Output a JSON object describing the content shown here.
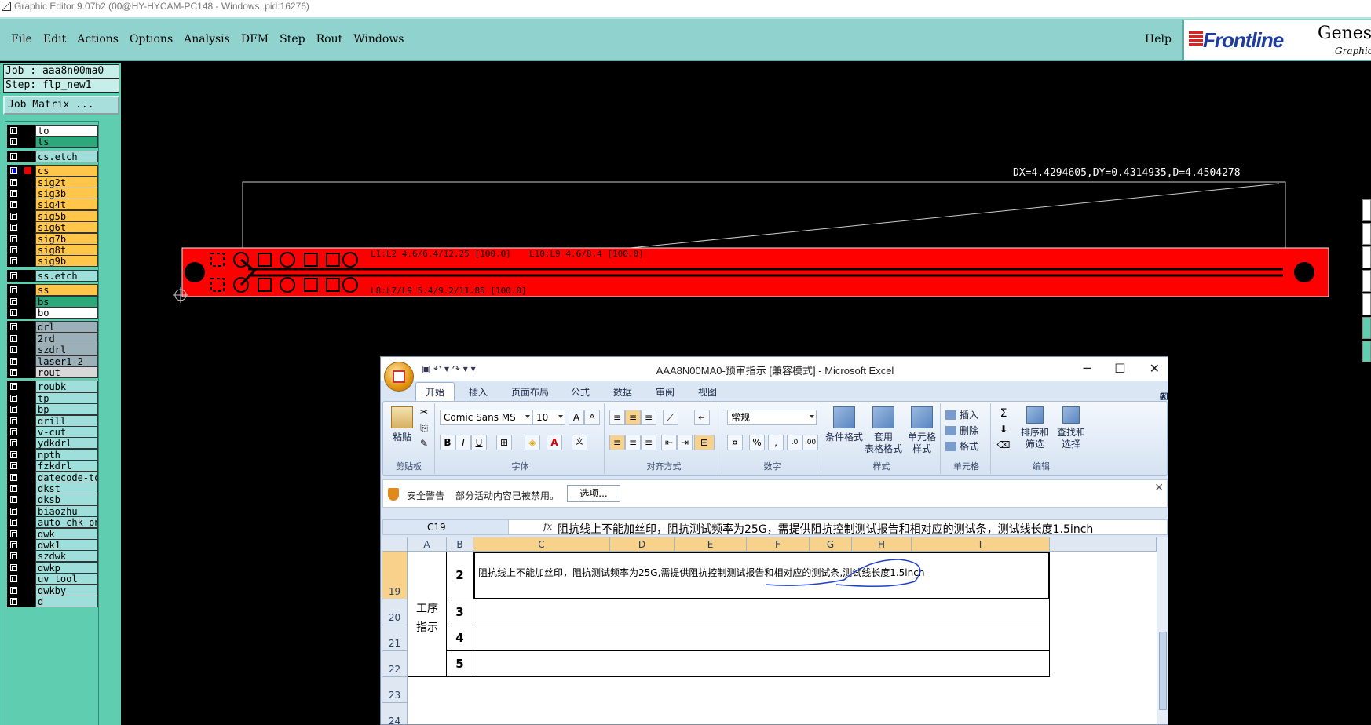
{
  "app": {
    "title": "Graphic Editor 9.07b2 (00@HY-HYCAM-PC148 - Windows, pid:16276)"
  },
  "menu": {
    "items": [
      "File",
      "Edit",
      "Actions",
      "Options",
      "Analysis",
      "DFM",
      "Step",
      "Rout",
      "Windows"
    ],
    "help": "Help"
  },
  "logo": {
    "brand": "Frontline",
    "product": "Genesis",
    "sub": "Graphic"
  },
  "job": {
    "job_label": "Job : aaa8n00ma0",
    "step_label": "Step: flp_new1",
    "matrix_button": "Job Matrix ..."
  },
  "layers": [
    {
      "name": "to",
      "color": "#ffffff"
    },
    {
      "name": "ts",
      "color": "#2ca87a"
    },
    {
      "name": "cs.etch",
      "color": "#9fdfdb"
    },
    {
      "name": "cs",
      "color": "#ffc64a",
      "active": true
    },
    {
      "name": "sig2t",
      "color": "#ffc64a"
    },
    {
      "name": "sig3b",
      "color": "#ffc64a"
    },
    {
      "name": "sig4t",
      "color": "#ffc64a"
    },
    {
      "name": "sig5b",
      "color": "#ffc64a"
    },
    {
      "name": "sig6t",
      "color": "#ffc64a"
    },
    {
      "name": "sig7b",
      "color": "#ffc64a"
    },
    {
      "name": "sig8t",
      "color": "#ffc64a"
    },
    {
      "name": "sig9b",
      "color": "#ffc64a"
    },
    {
      "name": "ss.etch",
      "color": "#9fdfdb"
    },
    {
      "name": "ss",
      "color": "#ffc64a"
    },
    {
      "name": "bs",
      "color": "#2ca87a"
    },
    {
      "name": "bo",
      "color": "#ffffff"
    },
    {
      "name": "drl",
      "color": "#9bb0b8"
    },
    {
      "name": "2rd",
      "color": "#9bb0b8"
    },
    {
      "name": "szdrl",
      "color": "#9bb0b8"
    },
    {
      "name": "laser1-2",
      "color": "#9bb0b8"
    },
    {
      "name": "rout",
      "color": "#d8d8d8"
    },
    {
      "name": "roubk",
      "color": "#9fdfdb"
    },
    {
      "name": "tp",
      "color": "#9fdfdb"
    },
    {
      "name": "bp",
      "color": "#9fdfdb"
    },
    {
      "name": "drill",
      "color": "#9fdfdb"
    },
    {
      "name": "v-cut",
      "color": "#9fdfdb"
    },
    {
      "name": "ydkdrl",
      "color": "#9fdfdb"
    },
    {
      "name": "npth",
      "color": "#9fdfdb"
    },
    {
      "name": "fzkdrl",
      "color": "#9fdfdb"
    },
    {
      "name": "datecode-to",
      "color": "#9fdfdb"
    },
    {
      "name": "dkst",
      "color": "#9fdfdb"
    },
    {
      "name": "dksb",
      "color": "#9fdfdb"
    },
    {
      "name": "biaozhu",
      "color": "#9fdfdb"
    },
    {
      "name": "auto_chk_pn",
      "color": "#9fdfdb"
    },
    {
      "name": "dwk",
      "color": "#9fdfdb"
    },
    {
      "name": "dwk1",
      "color": "#9fdfdb"
    },
    {
      "name": "szdwk",
      "color": "#9fdfdb"
    },
    {
      "name": "dwkp",
      "color": "#9fdfdb"
    },
    {
      "name": "uv_tool",
      "color": "#9fdfdb"
    },
    {
      "name": "dwkby",
      "color": "#9fdfdb"
    },
    {
      "name": "d",
      "color": "#9fdfdb"
    }
  ],
  "canvas": {
    "measure": "DX=4.4294605,DY=0.4314935,D=4.4504278",
    "label_top1": "L1:L2 4.6/6.4/12.25 [100.0]",
    "label_top2": "L10:L9 4.6/8.4 [100.0]",
    "label_bottom": "L8:L7/L9 5.4/9.2/11.85 [100.0]"
  },
  "excel": {
    "title": "AAA8N00MA0-预审指示 [兼容模式] - Microsoft Excel",
    "tabs": [
      "开始",
      "插入",
      "页面布局",
      "公式",
      "数据",
      "审阅",
      "视图"
    ],
    "font_name": "Comic Sans MS",
    "font_size": "10",
    "number_format": "常规",
    "group_labels": {
      "clipboard": "剪贴板",
      "font": "字体",
      "alignment": "对齐方式",
      "number": "数字",
      "styles": "样式",
      "cells": "单元格",
      "editing": "编辑"
    },
    "buttons": {
      "paste": "粘贴",
      "cond_format": "条件格式",
      "table_format_1": "套用",
      "table_format_2": "表格格式",
      "cell_style_1": "单元格",
      "cell_style_2": "样式",
      "insert": "插入",
      "delete": "删除",
      "format": "格式",
      "sort_1": "排序和",
      "sort_2": "筛选",
      "find_1": "查找和",
      "find_2": "选择"
    },
    "security": {
      "title": "安全警告",
      "message": "部分活动内容已被禁用。",
      "options_button": "选项..."
    },
    "name_box": "C19",
    "formula": "阻抗线上不能加丝印，阻抗测试频率为25G，需提供阻抗控制测试报告和相对应的测试条，测试线长度1.5inch",
    "columns": [
      "A",
      "B",
      "C",
      "D",
      "E",
      "F",
      "G",
      "H",
      "I"
    ],
    "rows": [
      "19",
      "20",
      "21",
      "22",
      "23",
      "24"
    ],
    "cell_A": "工序\n指示",
    "cell_A_line1": "工序",
    "cell_A_line2": "指示",
    "b_values": [
      "2",
      "3",
      "4",
      "5"
    ],
    "c19_text": "阻抗线上不能加丝印，阻抗测试频率为25G,需提供阻抗控制测试报告和相对应的测试条,测试线长度1.5inch"
  }
}
